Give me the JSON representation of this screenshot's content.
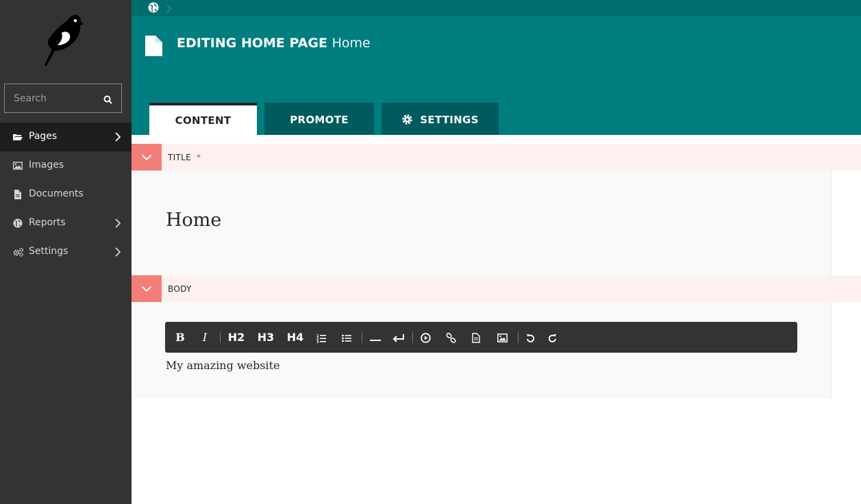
{
  "sidebar": {
    "search": {
      "placeholder": "Search"
    },
    "items": [
      {
        "label": "Pages",
        "icon": "folder-open-icon",
        "active": true,
        "has_submenu": true
      },
      {
        "label": "Images",
        "icon": "image-icon",
        "active": false,
        "has_submenu": false
      },
      {
        "label": "Documents",
        "icon": "document-icon",
        "active": false,
        "has_submenu": false
      },
      {
        "label": "Reports",
        "icon": "globe-icon",
        "active": false,
        "has_submenu": true
      },
      {
        "label": "Settings",
        "icon": "cogs-icon",
        "active": false,
        "has_submenu": true
      }
    ]
  },
  "header": {
    "title_action": "EDITING HOME PAGE",
    "title_page": "Home",
    "tabs": [
      {
        "label": "CONTENT",
        "active": true
      },
      {
        "label": "PROMOTE",
        "active": false
      },
      {
        "label": "SETTINGS",
        "active": false,
        "icon": "gear-icon"
      }
    ]
  },
  "fields": {
    "title": {
      "label": "TITLE",
      "required_mark": "*",
      "value": "Home"
    },
    "body": {
      "label": "BODY",
      "value": "My amazing website",
      "toolbar": {
        "bold": "B",
        "italic": "I",
        "h2": "H2",
        "h3": "H3",
        "h4": "H4"
      }
    }
  },
  "colors": {
    "sidebar": "#333333",
    "header": "#007d7e",
    "tab_inactive": "#005b5e",
    "field_header": "#fdf0ef",
    "field_toggle": "#f37e77"
  }
}
